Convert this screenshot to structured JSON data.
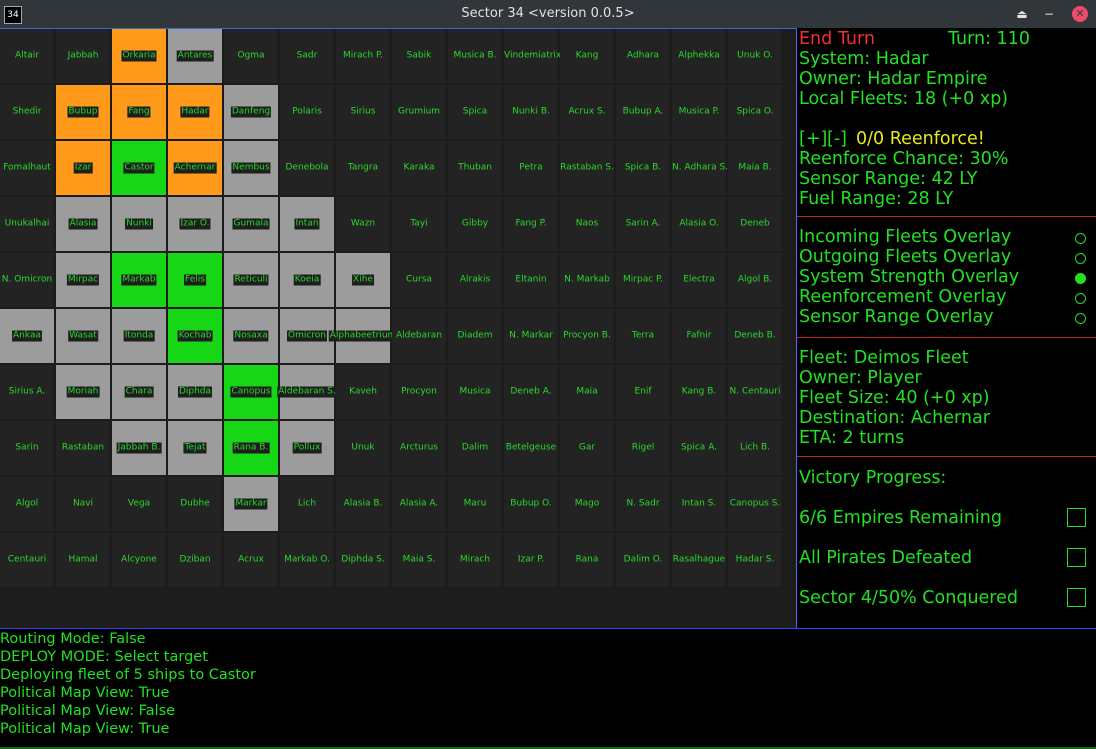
{
  "window": {
    "icon_label": "34",
    "title": "Sector 34    <version 0.0.5>",
    "restore_glyph": "⏏",
    "minimize_glyph": "−",
    "close_glyph": "✕"
  },
  "map": {
    "rows": [
      [
        {
          "n": "Altair"
        },
        {
          "n": "Jabbah"
        },
        {
          "n": "Orkaria",
          "c": "orange"
        },
        {
          "n": "Antares",
          "c": "grey"
        },
        {
          "n": "Ogma"
        },
        {
          "n": "Sadr"
        },
        {
          "n": "Mirach P."
        },
        {
          "n": "Sabik"
        },
        {
          "n": "Musica B."
        },
        {
          "n": "Vindemiatrix"
        },
        {
          "n": "Kang"
        },
        {
          "n": "Adhara"
        },
        {
          "n": "Alphekka"
        },
        {
          "n": "Unuk O."
        }
      ],
      [
        {
          "n": "Shedir"
        },
        {
          "n": "Bubup",
          "c": "orange"
        },
        {
          "n": "Fang",
          "c": "orange"
        },
        {
          "n": "Hadar",
          "c": "orange"
        },
        {
          "n": "Danfeng",
          "c": "grey"
        },
        {
          "n": "Polaris"
        },
        {
          "n": "Sirius"
        },
        {
          "n": "Grumium"
        },
        {
          "n": "Spica"
        },
        {
          "n": "Nunki B."
        },
        {
          "n": "Acrux S."
        },
        {
          "n": "Bubup A."
        },
        {
          "n": "Musica P."
        },
        {
          "n": "Spica O."
        }
      ],
      [
        {
          "n": "Fomalhaut"
        },
        {
          "n": "Izar",
          "c": "orange"
        },
        {
          "n": "Castor",
          "c": "green"
        },
        {
          "n": "Achernar",
          "c": "orange"
        },
        {
          "n": "Nembus",
          "c": "grey"
        },
        {
          "n": "Denebola"
        },
        {
          "n": "Tangra"
        },
        {
          "n": "Karaka"
        },
        {
          "n": "Thuban"
        },
        {
          "n": "Petra"
        },
        {
          "n": "Rastaban S."
        },
        {
          "n": "Spica B."
        },
        {
          "n": "N. Adhara S."
        },
        {
          "n": "Maia B."
        }
      ],
      [
        {
          "n": "Unukalhai"
        },
        {
          "n": "Alasia",
          "c": "grey"
        },
        {
          "n": "Nunki",
          "c": "grey"
        },
        {
          "n": "Izar O.",
          "c": "grey"
        },
        {
          "n": "Gumala",
          "c": "grey"
        },
        {
          "n": "Intan",
          "c": "grey"
        },
        {
          "n": "Wazn"
        },
        {
          "n": "Tayi"
        },
        {
          "n": "Gibby"
        },
        {
          "n": "Fang P."
        },
        {
          "n": "Naos"
        },
        {
          "n": "Sarin A."
        },
        {
          "n": "Alasia O."
        },
        {
          "n": "Deneb"
        }
      ],
      [
        {
          "n": "N. Omicron"
        },
        {
          "n": "Mirpac",
          "c": "grey"
        },
        {
          "n": "Markab",
          "c": "green"
        },
        {
          "n": "Felis",
          "c": "green"
        },
        {
          "n": "Reticuli",
          "c": "grey"
        },
        {
          "n": "Koeia",
          "c": "grey"
        },
        {
          "n": "Xihe",
          "c": "grey"
        },
        {
          "n": "Cursa"
        },
        {
          "n": "Alrakis"
        },
        {
          "n": "Eltanin"
        },
        {
          "n": "N. Markab"
        },
        {
          "n": "Mirpac P."
        },
        {
          "n": "Electra"
        },
        {
          "n": "Algol B."
        }
      ],
      [
        {
          "n": "Ankaa",
          "c": "grey"
        },
        {
          "n": "Wasat",
          "c": "grey"
        },
        {
          "n": "Itonda",
          "c": "grey"
        },
        {
          "n": "Kochab",
          "c": "green"
        },
        {
          "n": "Nosaxa",
          "c": "grey"
        },
        {
          "n": "Omicron",
          "c": "grey"
        },
        {
          "n": "Alphabeetrium",
          "c": "grey"
        },
        {
          "n": "Aldebaran"
        },
        {
          "n": "Diadem"
        },
        {
          "n": "N. Markar"
        },
        {
          "n": "Procyon B."
        },
        {
          "n": "Terra"
        },
        {
          "n": "Fafnir"
        },
        {
          "n": "Deneb B."
        }
      ],
      [
        {
          "n": "Sirius A."
        },
        {
          "n": "Moriah",
          "c": "grey"
        },
        {
          "n": "Chara",
          "c": "grey"
        },
        {
          "n": "Diphda",
          "c": "grey"
        },
        {
          "n": "Canopus",
          "c": "green"
        },
        {
          "n": "Aldebaran S.",
          "c": "grey"
        },
        {
          "n": "Kaveh"
        },
        {
          "n": "Procyon"
        },
        {
          "n": "Musica"
        },
        {
          "n": "Deneb A."
        },
        {
          "n": "Maia"
        },
        {
          "n": "Enif"
        },
        {
          "n": "Kang B."
        },
        {
          "n": "N. Centauri"
        }
      ],
      [
        {
          "n": "Sarin"
        },
        {
          "n": "Rastaban"
        },
        {
          "n": "Jabbah B.",
          "c": "grey"
        },
        {
          "n": "Tejat",
          "c": "grey"
        },
        {
          "n": "Rana B.",
          "c": "green"
        },
        {
          "n": "Pollux",
          "c": "grey"
        },
        {
          "n": "Unuk"
        },
        {
          "n": "Arcturus"
        },
        {
          "n": "Dalim"
        },
        {
          "n": "Betelgeuse"
        },
        {
          "n": "Gar"
        },
        {
          "n": "Rigel"
        },
        {
          "n": "Spica A."
        },
        {
          "n": "Lich B."
        }
      ],
      [
        {
          "n": "Algol"
        },
        {
          "n": "Navi"
        },
        {
          "n": "Vega"
        },
        {
          "n": "Dubhe"
        },
        {
          "n": "Markar",
          "c": "grey"
        },
        {
          "n": "Lich"
        },
        {
          "n": "Alasia B."
        },
        {
          "n": "Alasia A."
        },
        {
          "n": "Maru"
        },
        {
          "n": "Bubup O."
        },
        {
          "n": "Mago"
        },
        {
          "n": "N. Sadr"
        },
        {
          "n": "Intan S."
        },
        {
          "n": "Canopus S."
        }
      ],
      [
        {
          "n": "Centauri"
        },
        {
          "n": "Hamal"
        },
        {
          "n": "Alcyone"
        },
        {
          "n": "Dziban"
        },
        {
          "n": "Acrux"
        },
        {
          "n": "Markab O."
        },
        {
          "n": "Diphda S."
        },
        {
          "n": "Maia S."
        },
        {
          "n": "Mirach"
        },
        {
          "n": "Izar P."
        },
        {
          "n": "Rana"
        },
        {
          "n": "Dalim O."
        },
        {
          "n": "Rasalhague"
        },
        {
          "n": "Hadar S."
        }
      ]
    ]
  },
  "panel": {
    "end_turn": "End Turn",
    "turn": "Turn: 110",
    "system": "System: Hadar",
    "owner": "Owner: Hadar Empire",
    "local_fleets": "Local Fleets: 18 (+0 xp)",
    "plus": "[+]",
    "minus": "[-]",
    "reenforce": "0/0 Reenforce!",
    "reenforce_chance": "Reenforce Chance: 30%",
    "sensor_range": "Sensor Range: 42 LY",
    "fuel_range": "Fuel Range: 28 LY",
    "overlays": [
      {
        "label": "Incoming Fleets Overlay",
        "on": false
      },
      {
        "label": "Outgoing Fleets Overlay",
        "on": false
      },
      {
        "label": "System Strength Overlay",
        "on": true
      },
      {
        "label": "Reenforcement Overlay",
        "on": false
      },
      {
        "label": "Sensor Range Overlay",
        "on": false
      }
    ],
    "fleet": "Fleet: Deimos Fleet",
    "fleet_owner": "Owner: Player",
    "fleet_size": "Fleet Size: 40 (+0 xp)",
    "destination": "Destination: Achernar",
    "eta": "ETA: 2 turns",
    "victory_title": "Victory Progress:",
    "victory": [
      {
        "label": "6/6 Empires Remaining",
        "checked": false
      },
      {
        "label": "All Pirates Defeated",
        "checked": false
      },
      {
        "label": "Sector 4/50% Conquered",
        "checked": false
      }
    ]
  },
  "log": [
    "Routing Mode: False",
    "DEPLOY MODE: Select target",
    "Deploying fleet of 5 ships to Castor",
    "Political Map View: True",
    "Political Map View: False",
    "Political Map View: True"
  ],
  "colors": {
    "text_green": "#22e022",
    "owned_orange": "#ff9a1a",
    "player_green": "#16d616",
    "neutral_grey": "#9c9c9c",
    "end_turn_red": "#f03030",
    "reenforce_yellow": "#e8e81c"
  }
}
